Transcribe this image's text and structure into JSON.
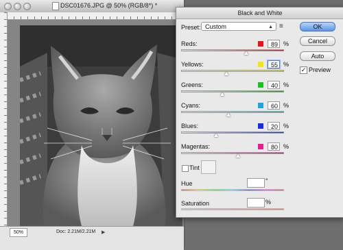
{
  "document": {
    "title": "DSC01676.JPG @ 50% (RGB/8*) *",
    "zoom": "50%",
    "doc_info": "Doc: 2.21M/2.21M"
  },
  "dialog": {
    "title": "Black and White",
    "preset_label": "Preset:",
    "preset_value": "Custom",
    "ok_label": "OK",
    "cancel_label": "Cancel",
    "auto_label": "Auto",
    "preview_label": "Preview",
    "preview_checked": true,
    "percent_sign": "%",
    "channels": [
      {
        "label": "Reds:",
        "value": "89",
        "color": "#e5141b",
        "gradient": [
          "#e7e7e7",
          "#d01c1c"
        ],
        "slider": 0.63
      },
      {
        "label": "Yellows:",
        "value": "55",
        "color": "#f2e41a",
        "gradient": [
          "#e7e7e7",
          "#e6d91a"
        ],
        "slider": 0.44,
        "focused": true
      },
      {
        "label": "Greens:",
        "value": "40",
        "color": "#18c21f",
        "gradient": [
          "#e7e7e7",
          "#1ca31f"
        ],
        "slider": 0.4
      },
      {
        "label": "Cyans:",
        "value": "60",
        "color": "#1fa5dd",
        "gradient": [
          "#e7e7e7",
          "#25b4c9"
        ],
        "slider": 0.46
      },
      {
        "label": "Blues:",
        "value": "20",
        "color": "#1c2ce0",
        "gradient": [
          "#e7e7e7",
          "#2231cf"
        ],
        "slider": 0.34
      },
      {
        "label": "Magentas:",
        "value": "80",
        "color": "#e41e8e",
        "gradient": [
          "#e7e7e7",
          "#c8228f"
        ],
        "slider": 0.55
      }
    ],
    "tint_label": "Tint",
    "hue_label": "Hue",
    "hue_unit": "°",
    "saturation_label": "Saturation",
    "saturation_unit": "%"
  }
}
